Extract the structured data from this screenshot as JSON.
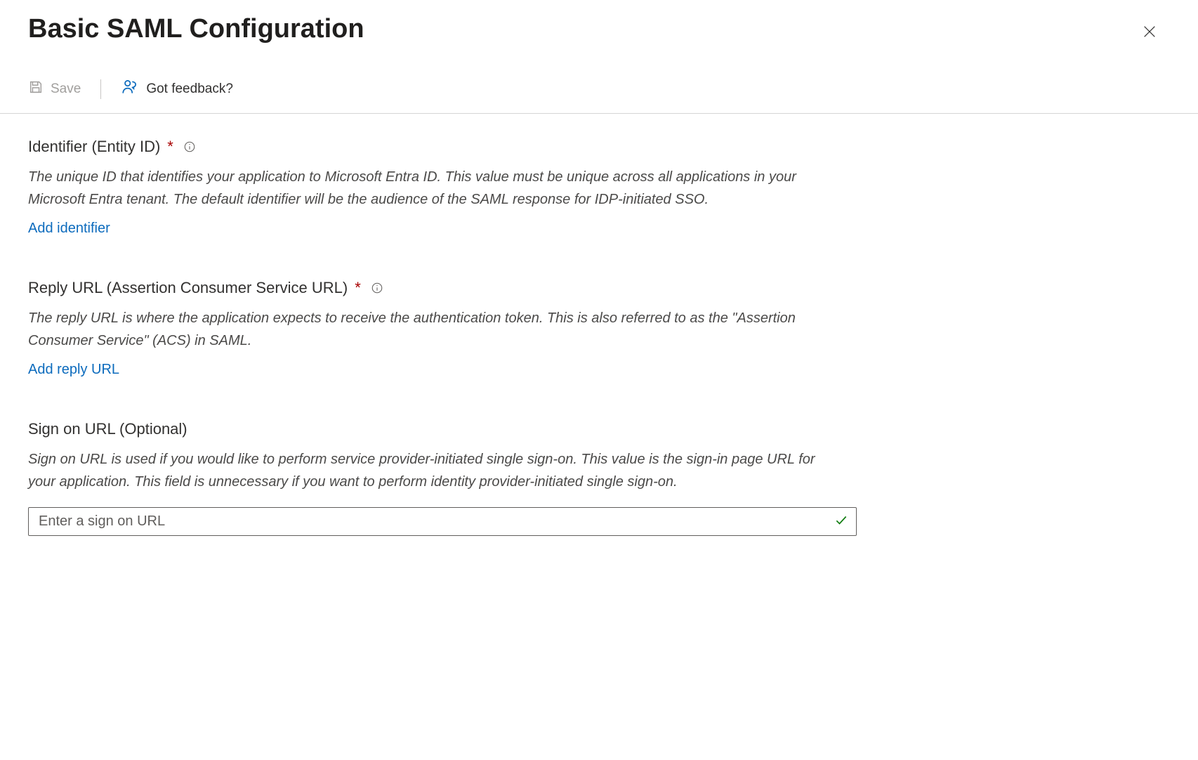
{
  "header": {
    "title": "Basic SAML Configuration"
  },
  "toolbar": {
    "save_label": "Save",
    "feedback_label": "Got feedback?"
  },
  "sections": {
    "identifier": {
      "heading": "Identifier (Entity ID)",
      "required": "*",
      "description": "The unique ID that identifies your application to Microsoft Entra ID. This value must be unique across all applications in your Microsoft Entra tenant. The default identifier will be the audience of the SAML response for IDP-initiated SSO.",
      "add_link": "Add identifier"
    },
    "reply_url": {
      "heading": "Reply URL (Assertion Consumer Service URL)",
      "required": "*",
      "description": "The reply URL is where the application expects to receive the authentication token. This is also referred to as the \"Assertion Consumer Service\" (ACS) in SAML.",
      "add_link": "Add reply URL"
    },
    "sign_on_url": {
      "heading": "Sign on URL (Optional)",
      "description": "Sign on URL is used if you would like to perform service provider-initiated single sign-on. This value is the sign-in page URL for your application. This field is unnecessary if you want to perform identity provider-initiated single sign-on.",
      "placeholder": "Enter a sign on URL"
    }
  }
}
